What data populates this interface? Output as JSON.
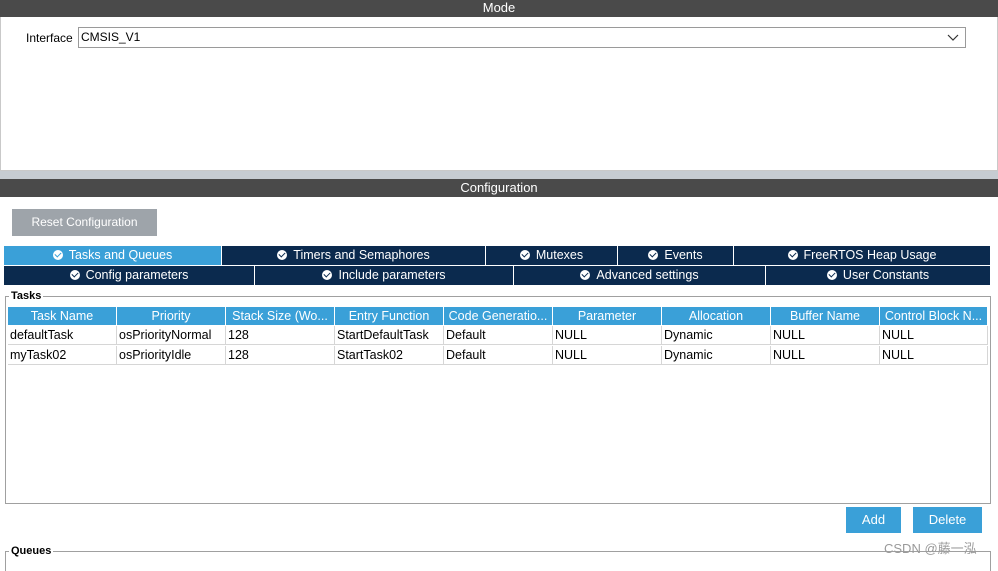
{
  "mode": {
    "title": "Mode",
    "interface_label": "Interface",
    "interface_value": "CMSIS_V1"
  },
  "configuration": {
    "title": "Configuration",
    "reset_label": "Reset Configuration",
    "tabs_row1": [
      {
        "label": "Tasks and Queues",
        "active": true
      },
      {
        "label": "Timers and Semaphores",
        "active": false
      },
      {
        "label": "Mutexes",
        "active": false
      },
      {
        "label": "Events",
        "active": false
      },
      {
        "label": "FreeRTOS Heap Usage",
        "active": false
      }
    ],
    "tabs_row2": [
      {
        "label": "Config parameters"
      },
      {
        "label": "Include parameters"
      },
      {
        "label": "Advanced settings"
      },
      {
        "label": "User Constants"
      }
    ]
  },
  "tasks": {
    "group_title": "Tasks",
    "columns": [
      "Task Name",
      "Priority",
      "Stack Size (Wo...",
      "Entry Function",
      "Code Generatio...",
      "Parameter",
      "Allocation",
      "Buffer Name",
      "Control Block N..."
    ],
    "rows": [
      [
        "defaultTask",
        "osPriorityNormal",
        "128",
        "StartDefaultTask",
        "Default",
        "NULL",
        "Dynamic",
        "NULL",
        "NULL"
      ],
      [
        "myTask02",
        "osPriorityIdle",
        "128",
        "StartTask02",
        "Default",
        "NULL",
        "Dynamic",
        "NULL",
        "NULL"
      ]
    ],
    "add_label": "Add",
    "delete_label": "Delete"
  },
  "queues": {
    "group_title": "Queues"
  },
  "watermark": "CSDN @藤一泓",
  "colors": {
    "header_bar": "#4a4a4a",
    "tab_dark": "#0b2a4e",
    "tab_active": "#3aa0d8",
    "reset_button": "#9ea4aa"
  }
}
